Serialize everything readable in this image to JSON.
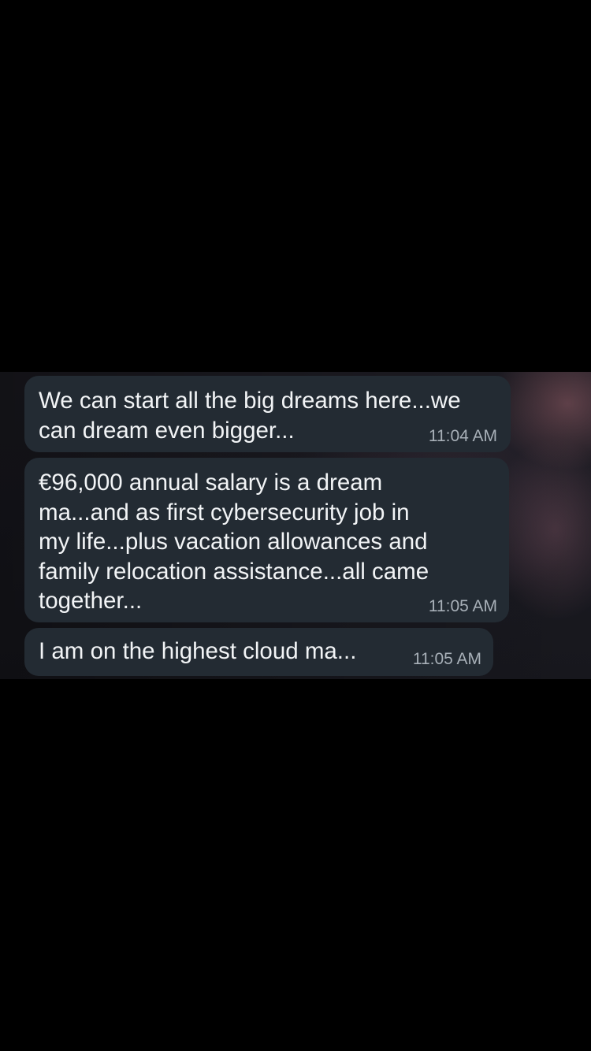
{
  "messages": [
    {
      "text": "We can start all the big dreams here...we\ncan dream even bigger...",
      "time": "11:04 AM"
    },
    {
      "text": "€96,000 annual salary is a dream\nma...and as first cybersecurity job in\nmy life...plus vacation allowances and\nfamily relocation assistance...all came\ntogether...",
      "time": "11:05 AM"
    },
    {
      "text": "I am on the highest cloud ma...",
      "time": "11:05 AM"
    }
  ],
  "colors": {
    "page_background": "#000000",
    "bubble_background": "#232b33",
    "bubble_text": "#f2f4f6",
    "timestamp_text": "#a8b0b8"
  }
}
